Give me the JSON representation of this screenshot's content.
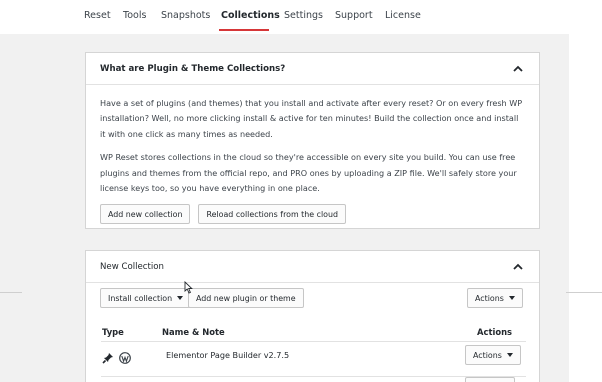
{
  "tabs": [
    {
      "label": "Reset"
    },
    {
      "label": "Tools"
    },
    {
      "label": "Snapshots"
    },
    {
      "label": "Collections",
      "active": true
    },
    {
      "label": "Settings"
    },
    {
      "label": "Support"
    },
    {
      "label": "License"
    }
  ],
  "accent_color": "#d63638",
  "info_card": {
    "title": "What are Plugin & Theme Collections?",
    "paragraph1": "Have a set of plugins (and themes) that you install and activate after every reset? Or on every fresh WP installation? Well, no more clicking install & active for ten minutes! Build the collection once and install it with one click as many times as needed.",
    "paragraph2": "WP Reset stores collections in the cloud so they're accessible on every site you build. You can use free plugins and themes from the official repo, and PRO ones by uploading a ZIP file. We'll safely store your license keys too, so you have everything in one place.",
    "add_button": "Add new collection",
    "reload_button": "Reload collections from the cloud",
    "collapse_icon": "chevron-up-icon"
  },
  "collection_card": {
    "title": "New Collection",
    "collapse_icon": "chevron-up-icon",
    "install_button": "Install collection",
    "add_plugin_button": "Add new plugin or theme",
    "actions_button": "Actions",
    "table": {
      "headers": {
        "type": "Type",
        "name": "Name & Note",
        "actions": "Actions"
      },
      "rows": [
        {
          "type_icons": [
            "plugin-icon",
            "wordpress-icon"
          ],
          "name": "Elementor Page Builder v2.7.5",
          "action": "Actions"
        }
      ]
    }
  }
}
